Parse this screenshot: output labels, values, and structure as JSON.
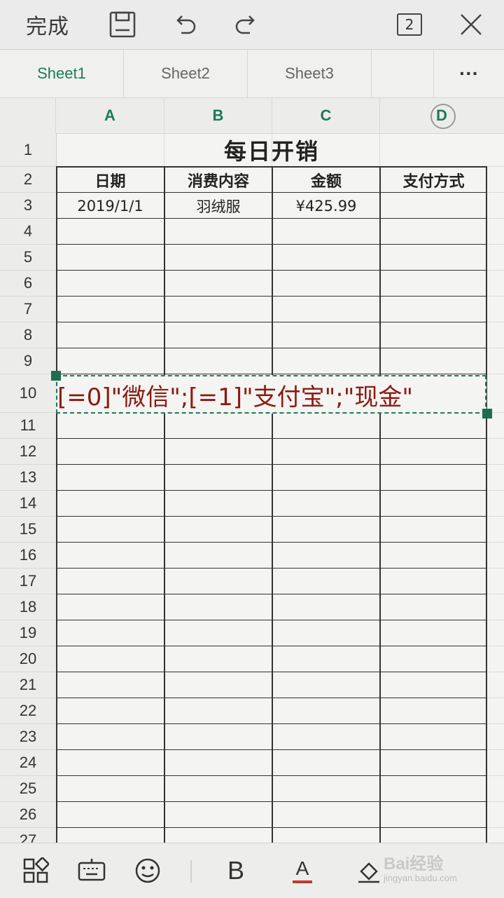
{
  "toolbar": {
    "done_label": "完成",
    "window_count": "2",
    "icons": [
      "save-icon",
      "undo-icon",
      "redo-icon",
      "close-icon"
    ]
  },
  "tabs": [
    {
      "label": "Sheet1",
      "active": true
    },
    {
      "label": "Sheet2",
      "active": false
    },
    {
      "label": "Sheet3",
      "active": false
    },
    {
      "label": "",
      "active": false
    }
  ],
  "more_label": "···",
  "columns": [
    "A",
    "B",
    "C",
    "D"
  ],
  "rows": [
    "1",
    "2",
    "3",
    "4",
    "5",
    "6",
    "7",
    "8",
    "9",
    "10",
    "11",
    "12",
    "13",
    "14",
    "15",
    "16",
    "17",
    "18",
    "19",
    "20",
    "21",
    "22",
    "23",
    "24",
    "25",
    "26",
    "27"
  ],
  "sheet": {
    "title": "每日开销",
    "headers": [
      "日期",
      "消费内容",
      "金额",
      "支付方式"
    ],
    "row3": [
      "2019/1/1",
      "羽绒服",
      "¥425.99",
      ""
    ]
  },
  "editing_cell": {
    "row": "10",
    "text": "[=0]\"微信\";[=1]\"支付宝\";\"现金\""
  },
  "bottom_toolbar": {
    "icons": [
      "apps-icon",
      "keyboard-icon",
      "emoji-icon",
      "bold-icon",
      "font-color-icon",
      "fill-color-icon"
    ],
    "bold_label": "B",
    "font_color_label": "A",
    "font_color": "#c0392b"
  },
  "watermark": {
    "brand": "Bai",
    "mark": "经验",
    "url": "jingyan.baidu.com"
  }
}
